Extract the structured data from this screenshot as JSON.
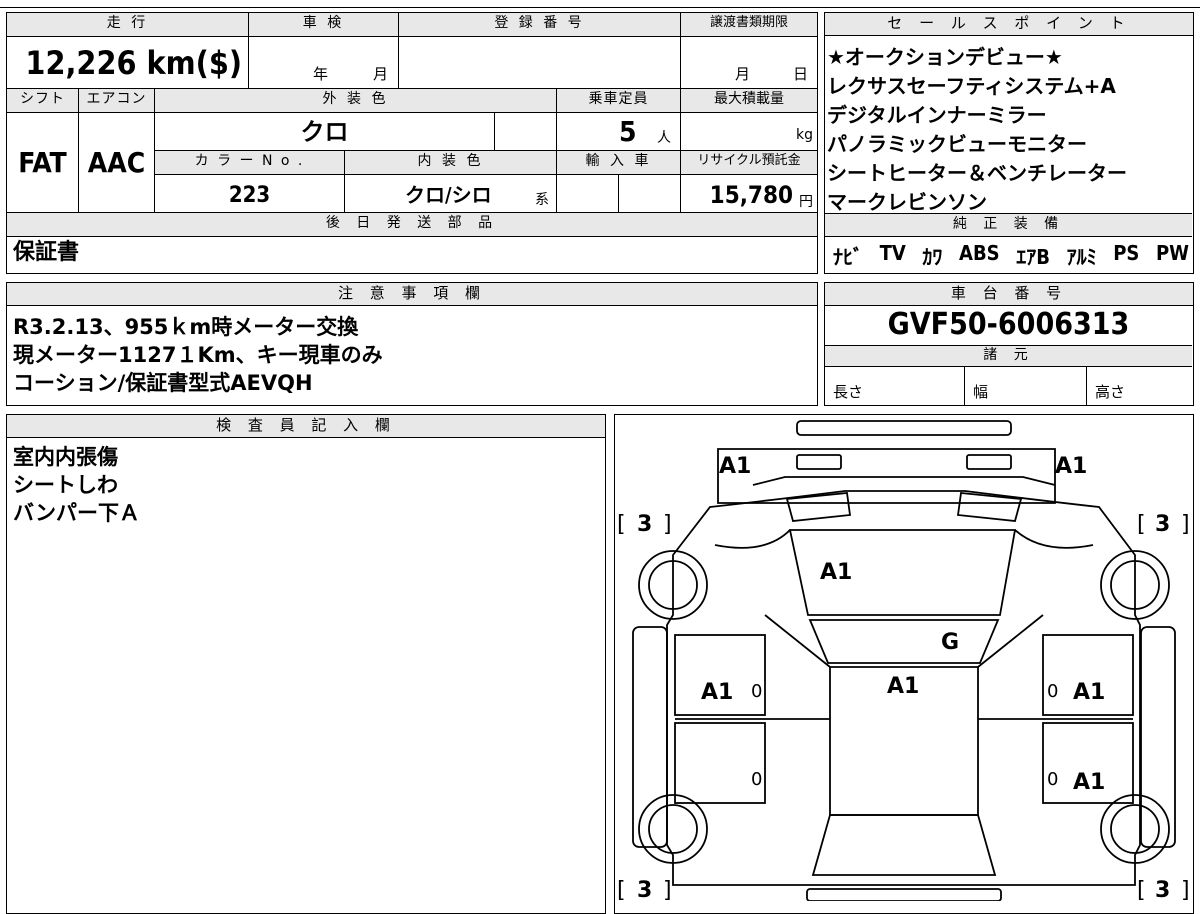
{
  "top_left": {
    "mileage_label": "走 行",
    "mileage_value": "12,226 km($)",
    "inspection_label": "車 検",
    "inspection_year": "年",
    "inspection_month": "月",
    "registration_label": "登 録 番 号",
    "transfer_label": "譲渡書類期限",
    "transfer_month": "月",
    "transfer_day": "日",
    "shift_label": "シフト",
    "ac_label": "エアコン",
    "exterior_label": "外 装 色",
    "capacity_label": "乗車定員",
    "max_load_label": "最大積載量",
    "shift_value": "FAT",
    "ac_value": "AAC",
    "exterior_value": "クロ",
    "capacity_value": "5",
    "capacity_unit": "人",
    "max_load_unit": "kg",
    "color_no_label": "カ ラ ー N o .",
    "interior_label": "内 装 色",
    "import_label": "輸 入 車",
    "recycle_label": "リサイクル預託金",
    "color_no_value": "223",
    "interior_value": "クロ/シロ",
    "interior_suffix": "系",
    "recycle_value": "15,780",
    "recycle_unit": "円",
    "later_parts_label": "後 日 発 送 部 品",
    "later_parts_value": "保証書"
  },
  "sales_points": {
    "label": "セ ー ル ス ポ イ ン ト",
    "lines": [
      "★オークションデビュー★",
      "レクサスセーフティシステム+A",
      "デジタルインナーミラー",
      "パノラミックビューモニター",
      "シートヒーター＆ベンチレーター",
      "マークレビンソン"
    ]
  },
  "genuine_equipment": {
    "label": "純 正 装 備",
    "items": [
      "ﾅﾋﾞ",
      "TV",
      "ｶﾜ",
      "ABS",
      "ｴｱB",
      "ｱﾙﾐ",
      "PS",
      "PW"
    ]
  },
  "notes": {
    "label": "注 意 事 項 欄",
    "lines": [
      "R3.2.13、955ｋm時メーター交換",
      "現メーター1127１Km、キー現車のみ",
      "コーション/保証書型式AEVQH"
    ]
  },
  "chassis": {
    "label": "車 台 番 号",
    "value": "GVF50-6006313",
    "specs_label": "諸 元",
    "length_label": "長さ",
    "width_label": "幅",
    "height_label": "高さ"
  },
  "inspector": {
    "label": "検 査 員 記 入 欄",
    "lines": [
      "室内内張傷",
      "シートしわ",
      "バンパー下Ａ"
    ]
  },
  "diagram": {
    "marks": {
      "front_left": "A1",
      "front_right": "A1",
      "hood": "A1",
      "windshield": "G",
      "roof": "A1",
      "left_front_door": "A1",
      "right_front_door": "A1",
      "right_rear_door": "A1",
      "door_zero_1": "0",
      "door_zero_2": "0",
      "door_zero_3": "0",
      "door_zero_4": "0"
    },
    "tires": {
      "front_left": "3",
      "front_right": "3",
      "rear_left": "3",
      "rear_right": "3"
    }
  }
}
